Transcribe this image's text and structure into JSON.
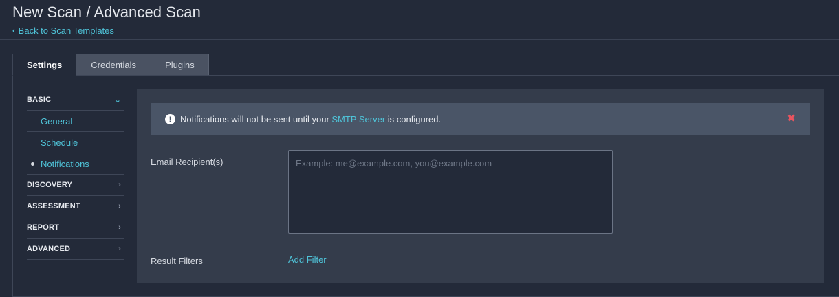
{
  "header": {
    "title": "New Scan / Advanced Scan",
    "back_label": "Back to Scan Templates"
  },
  "tabs": [
    {
      "label": "Settings",
      "active": true
    },
    {
      "label": "Credentials",
      "active": false
    },
    {
      "label": "Plugins",
      "active": false
    }
  ],
  "sidebar": {
    "sections": [
      {
        "label": "BASIC",
        "expanded": true,
        "items": [
          {
            "label": "General"
          },
          {
            "label": "Schedule"
          },
          {
            "label": "Notifications",
            "active": true
          }
        ]
      },
      {
        "label": "DISCOVERY",
        "expanded": false
      },
      {
        "label": "ASSESSMENT",
        "expanded": false
      },
      {
        "label": "REPORT",
        "expanded": false
      },
      {
        "label": "ADVANCED",
        "expanded": false
      }
    ]
  },
  "alert": {
    "icon": "exclamation-circle-icon",
    "text_before": "Notifications will not be sent until your ",
    "link_text": "SMTP Server",
    "text_after": " is configured.",
    "close_icon": "close-icon"
  },
  "form": {
    "email_label": "Email Recipient(s)",
    "email_placeholder": "Example: me@example.com, you@example.com",
    "email_value": "",
    "filters_label": "Result Filters",
    "add_filter_label": "Add Filter"
  },
  "colors": {
    "background": "#232a39",
    "accent": "#4fc3d8",
    "alert_bg": "#4a5567",
    "close": "#e8545f"
  }
}
